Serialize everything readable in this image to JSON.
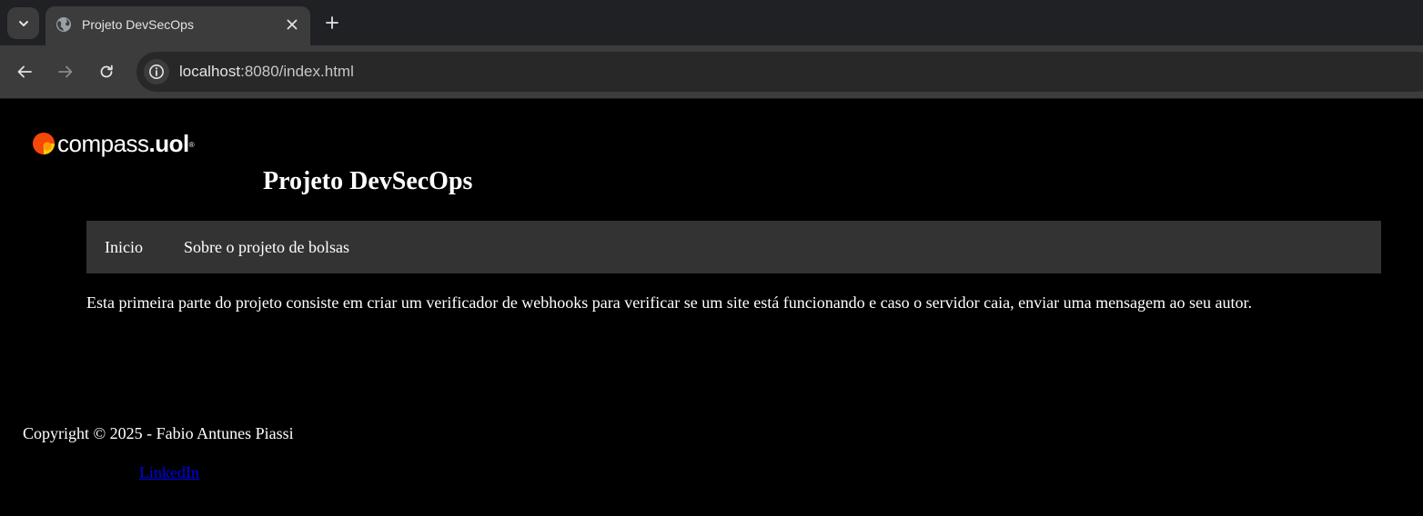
{
  "browser": {
    "tab": {
      "title": "Projeto DevSecOps",
      "favicon": "globe-icon"
    },
    "toolbar": {
      "back_icon": "arrow-left-icon",
      "forward_icon": "arrow-right-icon",
      "reload_icon": "reload-icon",
      "site_info_icon": "info-icon",
      "url_host": "localhost",
      "url_rest": ":8080/index.html"
    },
    "colors": {
      "chrome_dark": "#202124",
      "chrome_tab": "#3c3c3c",
      "omnibox": "#282828"
    }
  },
  "page": {
    "logo": {
      "text": "compass",
      "suffix": ".uol",
      "registered": "®",
      "mark_colors": [
        "#ff6b00",
        "#ffcc00",
        "#e30613"
      ]
    },
    "title": "Projeto DevSecOps",
    "nav": {
      "items": [
        {
          "label": "Inicio"
        },
        {
          "label": "Sobre o projeto de bolsas"
        }
      ]
    },
    "description": "Esta primeira parte do projeto consiste em criar um verificador de webhooks para verificar se um site está funcionando e caso o servidor caia, enviar uma mensagem ao seu autor.",
    "footer": {
      "copyright": "Copyright © 2025 - Fabio Antunes Piassi",
      "link_label": "LinkedIn"
    },
    "colors": {
      "background": "#000000",
      "text": "#ffffff",
      "navbar": "#333333",
      "link": "#0000ee"
    }
  }
}
